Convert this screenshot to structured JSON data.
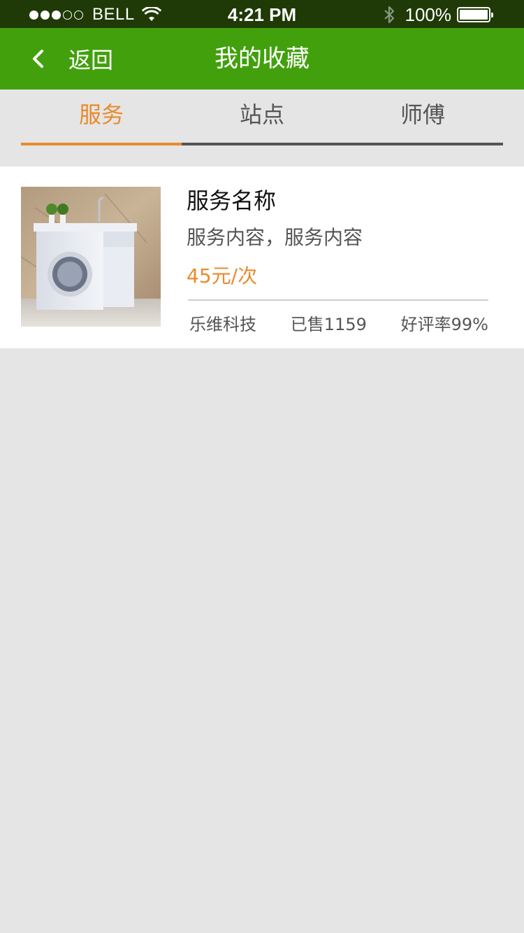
{
  "status_bar": {
    "carrier": "BELL",
    "time": "4:21 PM",
    "battery": "100%",
    "signal_dots_full": 3,
    "signal_dots_total": 5
  },
  "nav": {
    "back_label": "返回",
    "title": "我的收藏",
    "back_icon": "chevron-left-icon"
  },
  "tabs": [
    {
      "label": "服务",
      "active": true
    },
    {
      "label": "站点",
      "active": false
    },
    {
      "label": "师傅",
      "active": false
    }
  ],
  "favorites": [
    {
      "image": "washing-machine-cabinet-photo",
      "title": "服务名称",
      "description": "服务内容，服务内容",
      "price": "45元/次",
      "vendor": "乐维科技",
      "sold": "已售1159",
      "rating": "好评率99%"
    }
  ],
  "colors": {
    "nav_green": "#42a00d",
    "status_bar_bg": "#1f3a06",
    "accent_orange": "#ea8a2c",
    "page_bg": "#e5e5e5"
  }
}
